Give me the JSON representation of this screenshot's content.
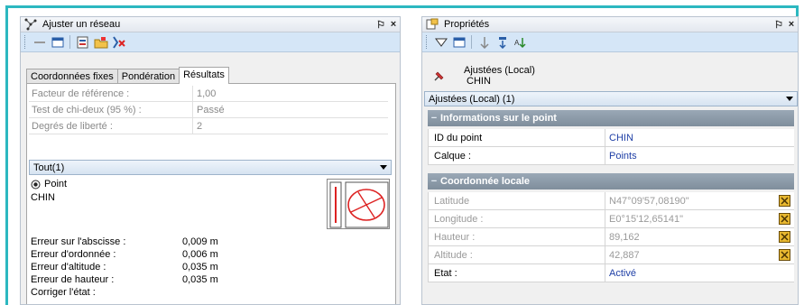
{
  "left_panel": {
    "title": "Ajuster un réseau",
    "pin": "ᵖ",
    "close": "×",
    "tabs": [
      "Coordonnées fixes",
      "Pondération",
      "Résultats"
    ],
    "stats": [
      {
        "label": "Facteur de référence :",
        "value": "1,00"
      },
      {
        "label": "Test de chi-deux (95 %) :",
        "value": "Passé"
      },
      {
        "label": "Degrés de liberté :",
        "value": "2"
      }
    ],
    "filter": "Tout(1)",
    "point_type": "Point",
    "point_name": "CHIN",
    "errors": [
      {
        "label": "Erreur sur l'abscisse :",
        "value": "0,009 m"
      },
      {
        "label": "Erreur d'ordonnée :",
        "value": "0,006 m"
      },
      {
        "label": "Erreur d'altitude :",
        "value": "0,035 m"
      },
      {
        "label": "Erreur de hauteur :",
        "value": "0,035 m"
      }
    ],
    "status_label": "Corriger l'état :"
  },
  "right_panel": {
    "title": "Propriétés",
    "pin": "ᵖ",
    "close": "×",
    "object_line1": "Ajustées (Local)",
    "object_line2": "CHIN",
    "selector": "Ajustées (Local) (1)",
    "section_info": "Informations sur le point",
    "info_rows": [
      {
        "label": "ID du point",
        "value": "CHIN"
      },
      {
        "label": "Calque :",
        "value": "Points"
      }
    ],
    "section_coord": "Coordonnée locale",
    "coord_rows": [
      {
        "label": "Latitude",
        "value": "N47°09'57,08190\""
      },
      {
        "label": "Longitude :",
        "value": "E0°15'12,65141\""
      },
      {
        "label": "Hauteur :",
        "value": "89,162"
      },
      {
        "label": "Altitude :",
        "value": "42,887"
      }
    ],
    "state_row": {
      "label": "Etat :",
      "value": "Activé"
    }
  },
  "colors": {
    "frame": "#2cb8c0",
    "toolbar": "#d5e6f7",
    "section": "#8a98a6",
    "link": "#1f3fa6"
  }
}
